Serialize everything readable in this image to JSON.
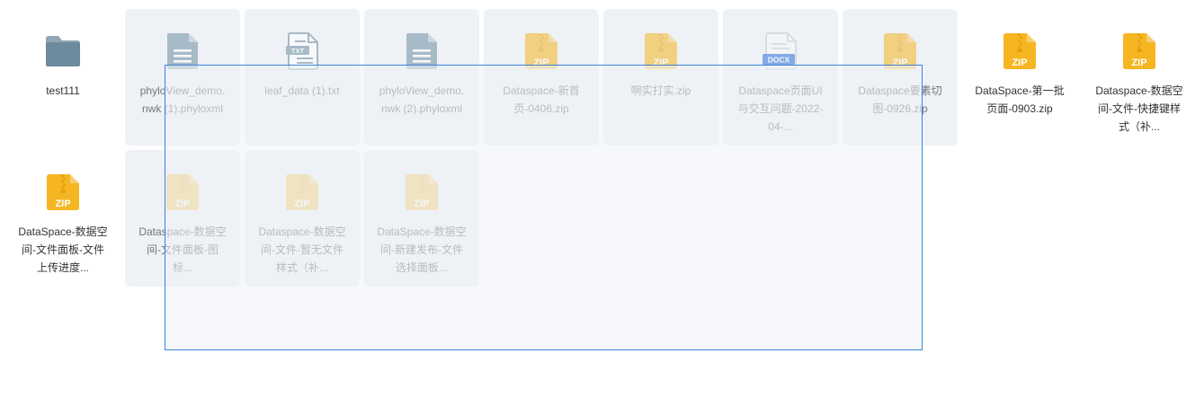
{
  "files": [
    {
      "name": "test111",
      "icon": "folder-icon",
      "type": "folder",
      "selected": false
    },
    {
      "name": "phyloView_demo.nwk (1).phyloxml",
      "icon": "document-icon",
      "type": "doc",
      "selected": true
    },
    {
      "name": "leaf_data (1).txt",
      "icon": "txt-file-icon",
      "type": "txt",
      "badge": "TXT",
      "selected": true
    },
    {
      "name": "phyloView_demo.nwk (2).phyloxml",
      "icon": "document-icon",
      "type": "doc",
      "selected": true
    },
    {
      "name": "Dataspace-新首页-0406.zip",
      "icon": "zip-file-icon",
      "type": "zip",
      "badge": "ZIP",
      "selected": true
    },
    {
      "name": "啊实打实.zip",
      "icon": "zip-file-icon",
      "type": "zip",
      "badge": "ZIP",
      "selected": true
    },
    {
      "name": "Dataspace页面UI与交互问题-2022-04-...",
      "icon": "docx-file-icon",
      "type": "docx",
      "badge": "DOCX",
      "selected": true
    },
    {
      "name": "Dataspace要素切图-0926.zip",
      "icon": "zip-file-icon",
      "type": "zip",
      "badge": "ZIP",
      "selected": true
    },
    {
      "name": "DataSpace-第一批页面-0903.zip",
      "icon": "zip-file-icon",
      "type": "zip",
      "badge": "ZIP",
      "selected": false
    },
    {
      "name": "Dataspace-数据空间-文件-快捷键样式（补...",
      "icon": "zip-file-icon",
      "type": "zip",
      "badge": "ZIP",
      "selected": false
    },
    {
      "name": "DataSpace-数据空间-文件面板-文件上传进度...",
      "icon": "zip-file-icon",
      "type": "zip",
      "badge": "ZIP",
      "selected": false
    },
    {
      "name": "Dataspace-数据空间-文件面板-图标...",
      "icon": "zip-file-icon",
      "type": "zip",
      "badge": "ZIP",
      "selected": true
    },
    {
      "name": "Dataspace-数据空间-文件-暂无文件样式（补...",
      "icon": "zip-file-icon",
      "type": "zip",
      "badge": "ZIP",
      "selected": true
    },
    {
      "name": "DataSpace-数据空间-新建发布-文件选择面板...",
      "icon": "zip-file-icon",
      "type": "zip",
      "badge": "ZIP",
      "selected": true
    }
  ],
  "colors": {
    "folder": "#6e8a9e",
    "doc": "#6e8ea3",
    "zip": "#f5b622",
    "zip_dark": "#e69d14",
    "docx": "#2f6fd6",
    "selection_border": "#3b84d6",
    "selected_tile": "#eef1f6"
  }
}
